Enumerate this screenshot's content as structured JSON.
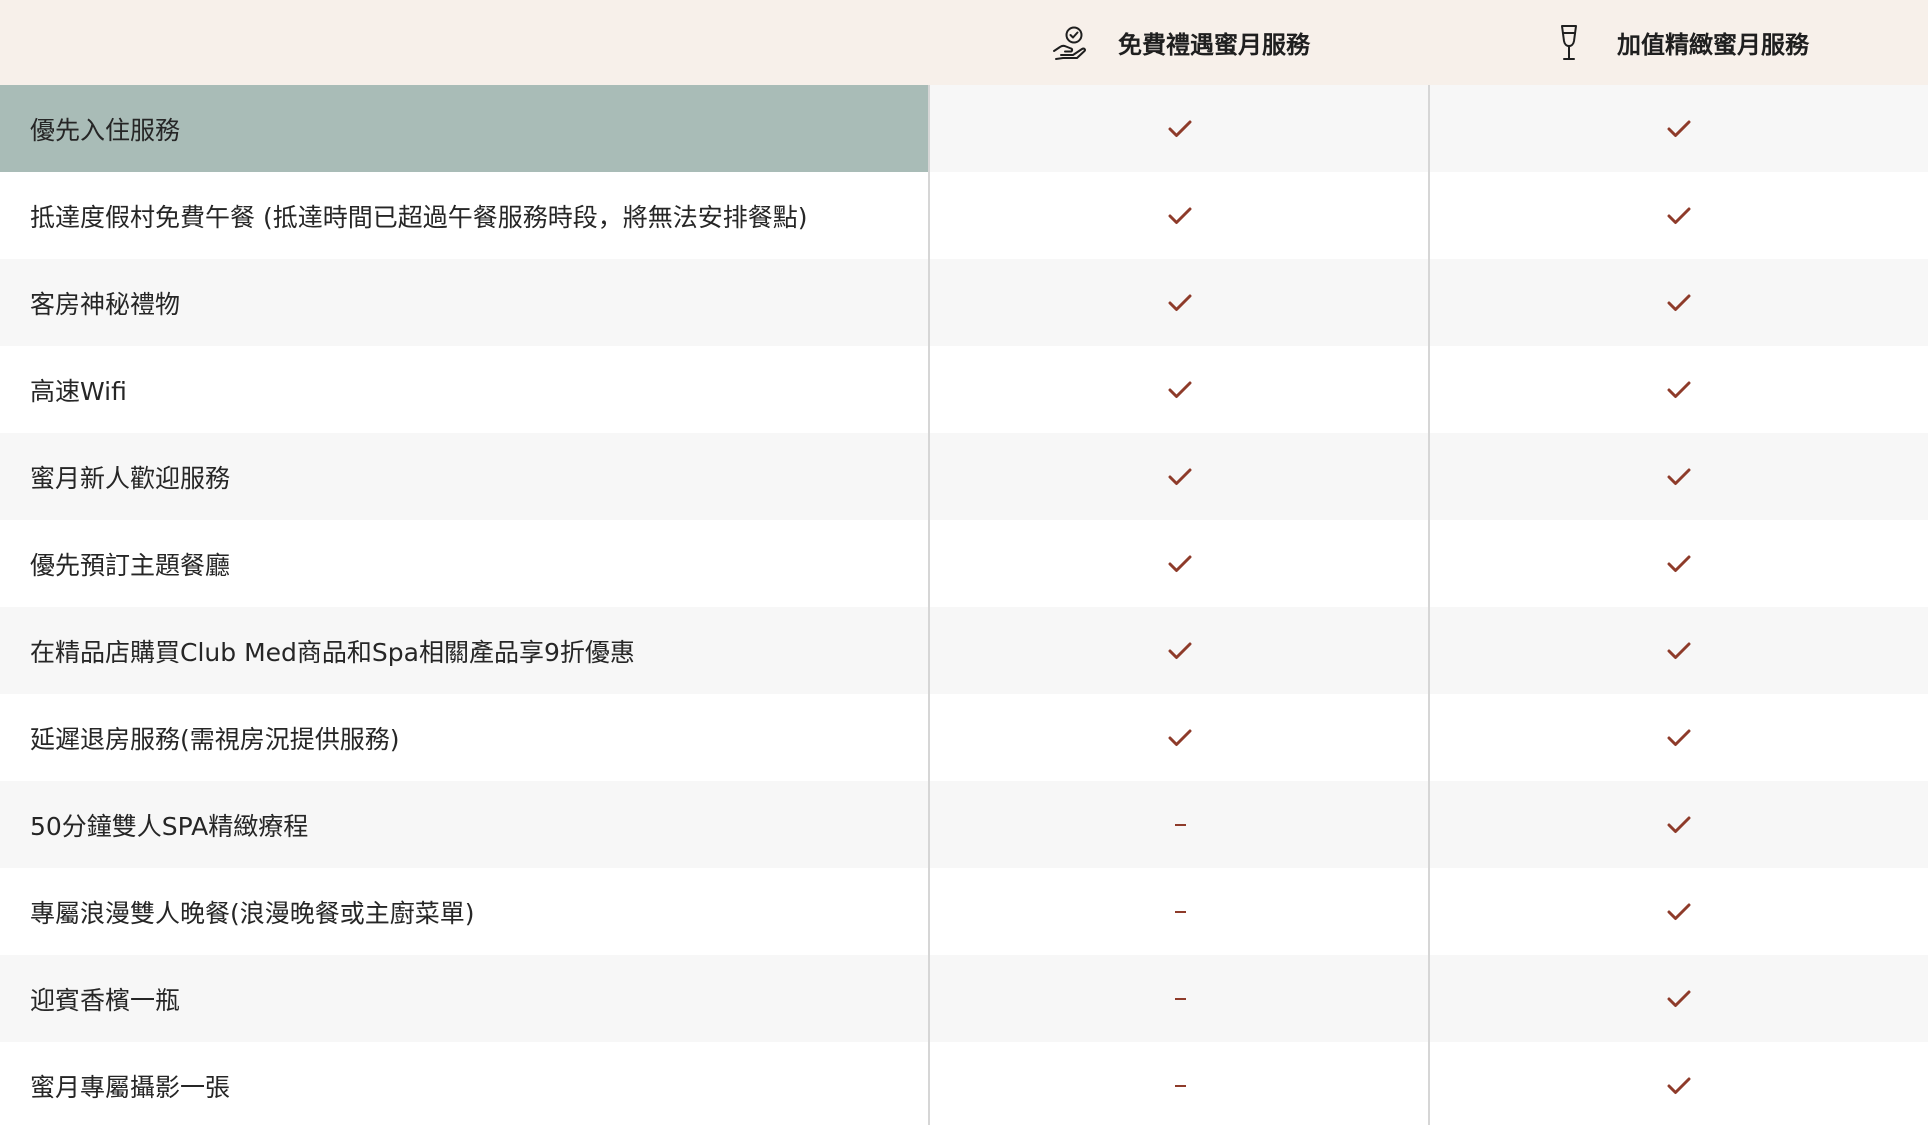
{
  "header": {
    "col1_label": "免費禮遇蜜月服務",
    "col1_icon": "hand-check-icon",
    "col2_label": "加值精緻蜜月服務",
    "col2_icon": "champagne-glass-icon"
  },
  "colors": {
    "header_bg": "#f7f0ea",
    "active_row_bg": "#a9bcb7",
    "alt_row_bg": "#f7f7f7",
    "mark_color": "#8e3b2a"
  },
  "rows": [
    {
      "label": "優先入住服務",
      "free": "check",
      "premium": "check"
    },
    {
      "label": "抵達度假村免費午餐 (抵達時間已超過午餐服務時段，將無法安排餐點)",
      "free": "check",
      "premium": "check"
    },
    {
      "label": "客房神秘禮物",
      "free": "check",
      "premium": "check"
    },
    {
      "label": "高速Wifi",
      "free": "check",
      "premium": "check"
    },
    {
      "label": "蜜月新人歡迎服務",
      "free": "check",
      "premium": "check"
    },
    {
      "label": "優先預訂主題餐廳",
      "free": "check",
      "premium": "check"
    },
    {
      "label": "在精品店購買Club Med商品和Spa相關產品享9折優惠",
      "free": "check",
      "premium": "check"
    },
    {
      "label": "延遲退房服務(需視房況提供服務)",
      "free": "check",
      "premium": "check"
    },
    {
      "label": "50分鐘雙人SPA精緻療程",
      "free": "dash",
      "premium": "check"
    },
    {
      "label": "專屬浪漫雙人晚餐(浪漫晚餐或主廚菜單)",
      "free": "dash",
      "premium": "check"
    },
    {
      "label": "迎賓香檳一瓶",
      "free": "dash",
      "premium": "check"
    },
    {
      "label": "蜜月專屬攝影一張",
      "free": "dash",
      "premium": "check"
    }
  ]
}
